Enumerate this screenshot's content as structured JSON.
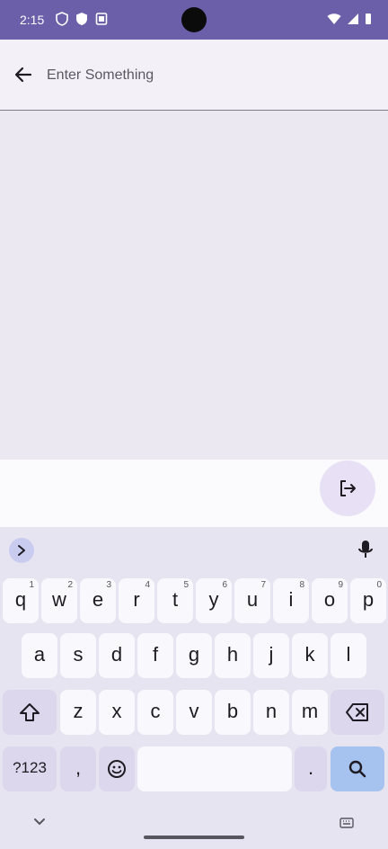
{
  "status_bar": {
    "time": "2:15",
    "background": "#6a5fa8",
    "left_icons": [
      "shield-icon",
      "vpn-shield-icon",
      "notification-icon"
    ],
    "right_icons": [
      "wifi-icon",
      "signal-icon",
      "battery-icon"
    ]
  },
  "app_bar": {
    "back_icon": "arrow-back-icon",
    "search_placeholder": "Enter Something",
    "search_value": ""
  },
  "action": {
    "exit_icon": "logout-icon"
  },
  "keyboard": {
    "row1": [
      {
        "label": "q",
        "hint": "1"
      },
      {
        "label": "w",
        "hint": "2"
      },
      {
        "label": "e",
        "hint": "3"
      },
      {
        "label": "r",
        "hint": "4"
      },
      {
        "label": "t",
        "hint": "5"
      },
      {
        "label": "y",
        "hint": "6"
      },
      {
        "label": "u",
        "hint": "7"
      },
      {
        "label": "i",
        "hint": "8"
      },
      {
        "label": "o",
        "hint": "9"
      },
      {
        "label": "p",
        "hint": "0"
      }
    ],
    "row2": [
      "a",
      "s",
      "d",
      "f",
      "g",
      "h",
      "j",
      "k",
      "l"
    ],
    "row3": [
      "z",
      "x",
      "c",
      "v",
      "b",
      "n",
      "m"
    ],
    "symbols_label": "?123",
    "comma_label": ",",
    "period_label": ".",
    "shift_icon": "shift-icon",
    "backspace_icon": "backspace-icon",
    "emoji_icon": "emoji-icon",
    "search_key_icon": "search-icon",
    "mic_icon": "microphone-icon",
    "toolbar_icon": "chevron-right-icon"
  },
  "nav_bar": {
    "hide_keyboard_icon": "chevron-down-icon",
    "switch_keyboard_icon": "keyboard-icon"
  }
}
